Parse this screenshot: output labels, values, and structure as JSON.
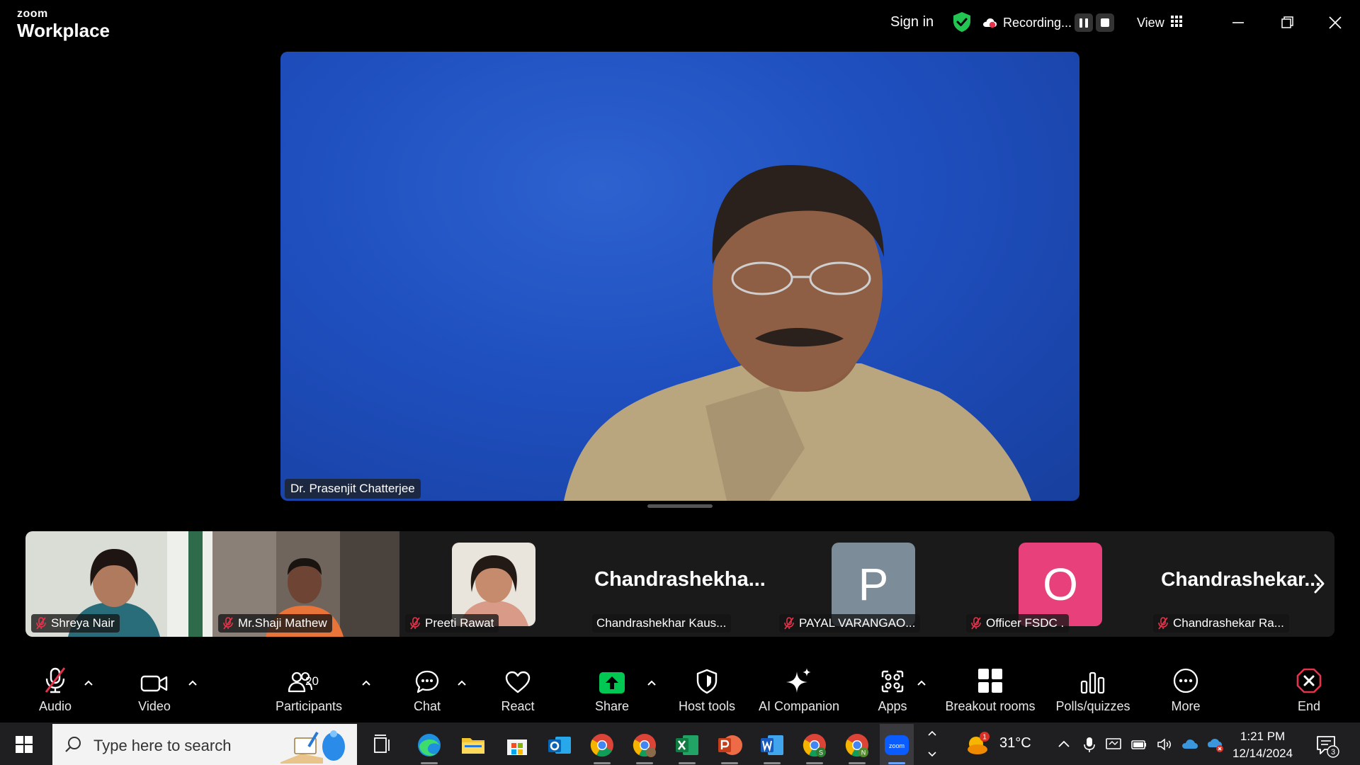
{
  "app": {
    "brand_small": "zoom",
    "brand_large": "Workplace",
    "sign_in": "Sign in",
    "recording": "Recording...",
    "view": "View",
    "accent": "#0b5cff"
  },
  "main_speaker": {
    "name": "Dr. Prasenjit Chatterjee",
    "background_color": "#1f4fbf"
  },
  "participants_strip": [
    {
      "name": "Shreya Nair",
      "type": "video",
      "muted": true
    },
    {
      "name": "Mr.Shaji Mathew",
      "type": "video",
      "muted": true
    },
    {
      "name": "Preeti Rawat",
      "type": "photo",
      "muted": true
    },
    {
      "name": "Chandrashekhar Kaus...",
      "display": "Chandrashekha...",
      "type": "name",
      "muted": false
    },
    {
      "name": "PAYAL VARANGAO...",
      "avatar_letter": "P",
      "avatar_color": "#7d8c99",
      "type": "letter",
      "muted": true
    },
    {
      "name": "Officer FSDC .",
      "avatar_letter": "O",
      "avatar_color": "#e8407a",
      "type": "letter",
      "muted": true
    },
    {
      "name": "Chandrashekar Ra...",
      "display": "Chandrashekar...",
      "type": "name",
      "muted": true
    }
  ],
  "toolbar": {
    "audio": "Audio",
    "video": "Video",
    "participants": "Participants",
    "participants_count": "20",
    "chat": "Chat",
    "react": "React",
    "share": "Share",
    "host_tools": "Host tools",
    "ai_companion": "AI Companion",
    "apps": "Apps",
    "breakout_rooms": "Breakout rooms",
    "polls": "Polls/quizzes",
    "more": "More",
    "end": "End",
    "share_color": "#00c853",
    "end_color": "#e5334b"
  },
  "taskbar": {
    "search_placeholder": "Type here to search",
    "temperature": "31°C",
    "weather_badge": "1",
    "time": "1:21 PM",
    "date": "12/14/2024",
    "notifications": "3",
    "apps": [
      "task-view",
      "edge",
      "file-explorer",
      "microsoft-store",
      "outlook",
      "chrome",
      "chrome-profile",
      "excel",
      "powerpoint",
      "word",
      "chrome-s",
      "chrome-n",
      "zoom"
    ]
  }
}
